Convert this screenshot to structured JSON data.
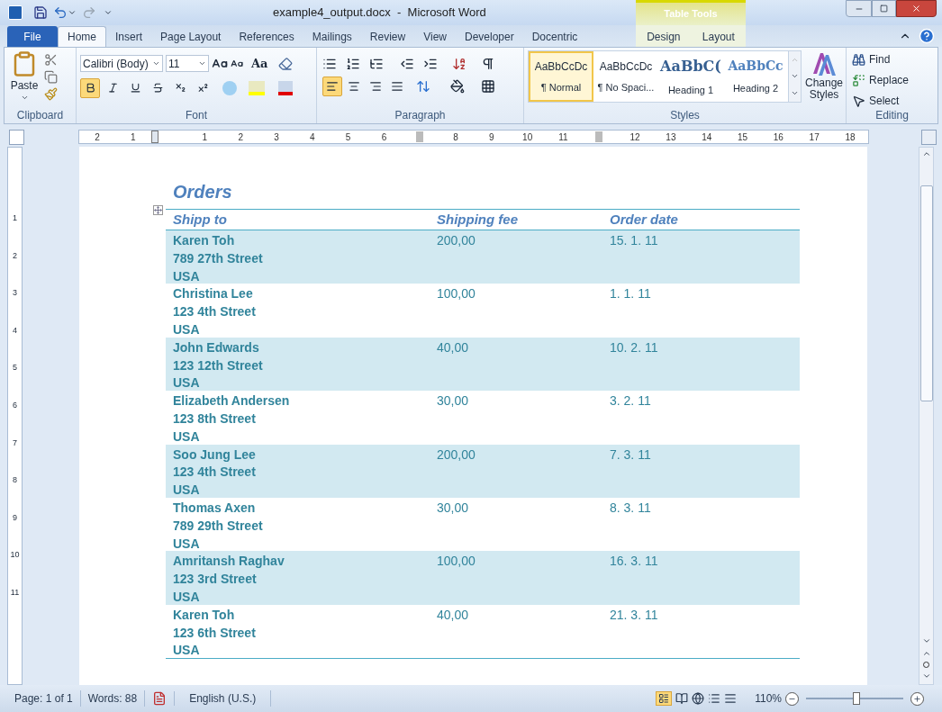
{
  "window": {
    "title": "example4_output.docx  -  Microsoft Word"
  },
  "tabs": [
    {
      "label": "File",
      "kind": "file",
      "selected": false
    },
    {
      "label": "Home",
      "kind": "tab",
      "selected": true
    },
    {
      "label": "Insert",
      "kind": "tab",
      "selected": false
    },
    {
      "label": "Page Layout",
      "kind": "tab",
      "selected": false
    },
    {
      "label": "References",
      "kind": "tab",
      "selected": false
    },
    {
      "label": "Mailings",
      "kind": "tab",
      "selected": false
    },
    {
      "label": "Review",
      "kind": "tab",
      "selected": false
    },
    {
      "label": "View",
      "kind": "tab",
      "selected": false
    },
    {
      "label": "Developer",
      "kind": "tab",
      "selected": false
    },
    {
      "label": "Docentric",
      "kind": "tab",
      "selected": false
    }
  ],
  "contextual": {
    "title": "Table Tools",
    "tabs": [
      {
        "label": "Design",
        "selected": false
      },
      {
        "label": "Layout",
        "selected": false
      }
    ]
  },
  "ribbon": {
    "clipboard": {
      "paste": "Paste",
      "group": "Clipboard"
    },
    "font": {
      "name": "Calibri (Body)",
      "size": "11",
      "case": "Aa",
      "group": "Font",
      "buttons": [
        {
          "kind": "bold",
          "selected": true
        },
        {
          "kind": "italic",
          "selected": false
        },
        {
          "kind": "underline",
          "selected": false
        },
        {
          "kind": "strike",
          "selected": false
        },
        {
          "kind": "subscript",
          "selected": false
        },
        {
          "kind": "superscript",
          "selected": false
        }
      ]
    },
    "paragraph": {
      "group": "Paragraph",
      "align": [
        {
          "kind": "left",
          "selected": true
        },
        {
          "kind": "center",
          "selected": false
        },
        {
          "kind": "right",
          "selected": false
        },
        {
          "kind": "justify",
          "selected": false
        }
      ]
    },
    "styles": {
      "group": "Styles",
      "change": "Change Styles",
      "items": [
        {
          "sample": "AaBbCcDc",
          "label": "¶ Normal",
          "kind": "normal",
          "selected": true
        },
        {
          "sample": "AaBbCcDc",
          "label": "¶ No Spaci...",
          "kind": "normal",
          "selected": false
        },
        {
          "sample": "AaBbC(",
          "label": "Heading 1",
          "kind": "heading1",
          "selected": false
        },
        {
          "sample": "AaBbCc",
          "label": "Heading 2",
          "kind": "heading2",
          "selected": false
        }
      ]
    },
    "editing": {
      "group": "Editing",
      "find": "Find",
      "replace": "Replace",
      "select": "Select"
    }
  },
  "ruler": [
    {
      "kind": "number",
      "label": "2"
    },
    {
      "kind": "number",
      "label": "1"
    },
    {
      "kind": "indent"
    },
    {
      "kind": "number",
      "label": "1"
    },
    {
      "kind": "number",
      "label": "2"
    },
    {
      "kind": "number",
      "label": "3"
    },
    {
      "kind": "number",
      "label": "4"
    },
    {
      "kind": "number",
      "label": "5"
    },
    {
      "kind": "number",
      "label": "6"
    },
    {
      "kind": "column"
    },
    {
      "kind": "number",
      "label": "8"
    },
    {
      "kind": "number",
      "label": "9"
    },
    {
      "kind": "number",
      "label": "10"
    },
    {
      "kind": "number",
      "label": "11"
    },
    {
      "kind": "column"
    },
    {
      "kind": "number",
      "label": "12"
    },
    {
      "kind": "number",
      "label": "13"
    },
    {
      "kind": "number",
      "label": "14"
    },
    {
      "kind": "number",
      "label": "15"
    },
    {
      "kind": "number",
      "label": "16"
    },
    {
      "kind": "number",
      "label": "17"
    },
    {
      "kind": "number",
      "label": "18"
    }
  ],
  "vruler": [
    "1",
    "2",
    "3",
    "4",
    "5",
    "6",
    "7",
    "8",
    "9",
    "10",
    "11"
  ],
  "document": {
    "heading": "Orders",
    "columns": [
      "Shipp to",
      "Shipping fee",
      "Order date"
    ],
    "rows": [
      {
        "shaded": true,
        "ship_to": [
          "Karen Toh",
          "789 27th Street",
          "USA"
        ],
        "fee": "200,00",
        "date": "15. 1. 11"
      },
      {
        "shaded": false,
        "ship_to": [
          "Christina Lee",
          "123 4th Street",
          "USA"
        ],
        "fee": "100,00",
        "date": "1. 1. 11"
      },
      {
        "shaded": true,
        "ship_to": [
          "John Edwards",
          "123 12th Street",
          "USA"
        ],
        "fee": "40,00",
        "date": "10. 2. 11"
      },
      {
        "shaded": false,
        "ship_to": [
          "Elizabeth Andersen",
          "123 8th Street",
          "USA"
        ],
        "fee": "30,00",
        "date": "3. 2. 11"
      },
      {
        "shaded": true,
        "ship_to": [
          "Soo Jung Lee",
          "123 4th Street",
          "USA"
        ],
        "fee": "200,00",
        "date": "7. 3. 11"
      },
      {
        "shaded": false,
        "ship_to": [
          "Thomas Axen",
          "789 29th Street",
          "USA"
        ],
        "fee": "30,00",
        "date": "8. 3. 11"
      },
      {
        "shaded": true,
        "ship_to": [
          "Amritansh Raghav",
          "123 3rd Street",
          "USA"
        ],
        "fee": "100,00",
        "date": "16. 3. 11"
      },
      {
        "shaded": false,
        "ship_to": [
          "Karen Toh",
          "123 6th Street",
          "USA"
        ],
        "fee": "40,00",
        "date": "21. 3. 11"
      }
    ]
  },
  "status_bar": {
    "page": "Page: 1 of 1",
    "words": "Words: 88",
    "language": "English (U.S.)",
    "zoom": "110%",
    "zoom_level": {
      "level": 0.52
    }
  }
}
